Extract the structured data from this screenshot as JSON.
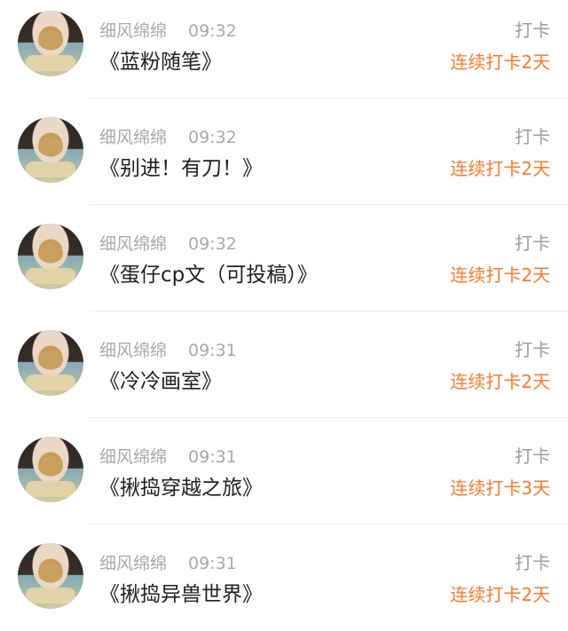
{
  "feed": {
    "items": [
      {
        "username": "细风绵绵",
        "time": "09:32",
        "title": "《蓝粉随笔》",
        "checkin_label": "打卡",
        "streak_text": "连续打卡2天"
      },
      {
        "username": "细风绵绵",
        "time": "09:32",
        "title": "《别进！有刀！》",
        "checkin_label": "打卡",
        "streak_text": "连续打卡2天"
      },
      {
        "username": "细风绵绵",
        "time": "09:32",
        "title": "《蛋仔cp文（可投稿）》",
        "checkin_label": "打卡",
        "streak_text": "连续打卡2天"
      },
      {
        "username": "细风绵绵",
        "time": "09:31",
        "title": "《冷冷画室》",
        "checkin_label": "打卡",
        "streak_text": "连续打卡2天"
      },
      {
        "username": "细风绵绵",
        "time": "09:31",
        "title": "《揪捣穿越之旅》",
        "checkin_label": "打卡",
        "streak_text": "连续打卡3天"
      },
      {
        "username": "细风绵绵",
        "time": "09:31",
        "title": "《揪捣异兽世界》",
        "checkin_label": "打卡",
        "streak_text": "连续打卡2天"
      }
    ]
  },
  "colors": {
    "username": "#a9a9a9",
    "title": "#1f1f1f",
    "checkin": "#9d9d9d",
    "streak": "#ff7a2f",
    "divider": "#eeeeee"
  }
}
